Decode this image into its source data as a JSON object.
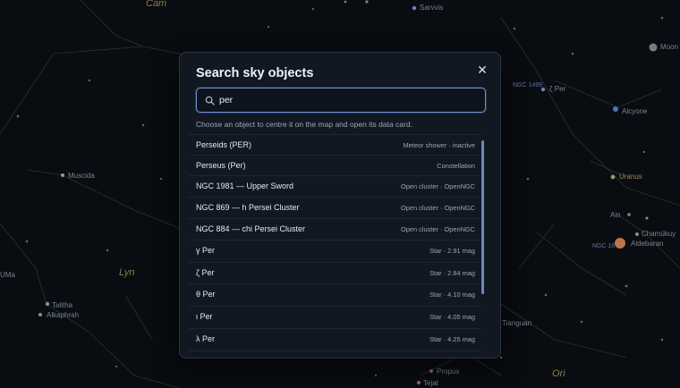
{
  "sky": {
    "labels": [
      {
        "text": "Cam",
        "style": "gold"
      },
      {
        "text": "Sarvvis",
        "style": "plain"
      },
      {
        "text": "Moon",
        "style": "plain"
      },
      {
        "text": "NGC 1499",
        "style": "blue"
      },
      {
        "text": "ζ Per",
        "style": "plain"
      },
      {
        "text": "Alcyone",
        "style": "plain"
      },
      {
        "text": "Muscida",
        "style": "plain"
      },
      {
        "text": "Uranus",
        "style": "goldsm"
      },
      {
        "text": "Ain",
        "style": "plain"
      },
      {
        "text": "Chamūkuy",
        "style": "plain"
      },
      {
        "text": "NGC 16",
        "style": "blue"
      },
      {
        "text": "Aldebaran",
        "style": "plain"
      },
      {
        "text": "Lyn",
        "style": "gold"
      },
      {
        "text": "UMa",
        "style": "plain"
      },
      {
        "text": "Talitha",
        "style": "plain"
      },
      {
        "text": "Alkaphrah",
        "style": "plain"
      },
      {
        "text": "Tianguan",
        "style": "plain"
      },
      {
        "text": "Propus",
        "style": "plain"
      },
      {
        "text": "Tejat",
        "style": "plain"
      },
      {
        "text": "Ori",
        "style": "gold"
      }
    ]
  },
  "dialog": {
    "title": "Search sky objects",
    "close_glyph": "✕",
    "search": {
      "value": "per",
      "placeholder": ""
    },
    "hint": "Choose an object to centre it on the map and open its data card.",
    "results": [
      {
        "name": "Perseids (PER)",
        "meta": "Meteor shower · inactive"
      },
      {
        "name": "Perseus (Per)",
        "meta": "Constellation"
      },
      {
        "name": "NGC 1981 — Upper Sword",
        "meta": "Open cluster · OpenNGC"
      },
      {
        "name": "NGC 869 — h Persei Cluster",
        "meta": "Open cluster · OpenNGC"
      },
      {
        "name": "NGC 884 — chi Persei Cluster",
        "meta": "Open cluster · OpenNGC"
      },
      {
        "name": "γ Per",
        "meta": "Star · 2.91 mag"
      },
      {
        "name": "ζ Per",
        "meta": "Star · 2.84 mag"
      },
      {
        "name": "θ Per",
        "meta": "Star · 4.10 mag"
      },
      {
        "name": "ι Per",
        "meta": "Star · 4.05 mag"
      },
      {
        "name": "λ Per",
        "meta": "Star · 4.25 mag"
      }
    ]
  },
  "colors": {
    "background": "#0b0e13",
    "dialog": "#121822",
    "accent": "#6d8fd0",
    "constellation_line": "#2a4a3c",
    "star": "#9aa3b0",
    "moon": "#8c8c8c",
    "aldebaran": "#d9835a",
    "uranus": "#8fb88d"
  },
  "icons": {
    "search": "search-icon",
    "close": "close-icon"
  }
}
